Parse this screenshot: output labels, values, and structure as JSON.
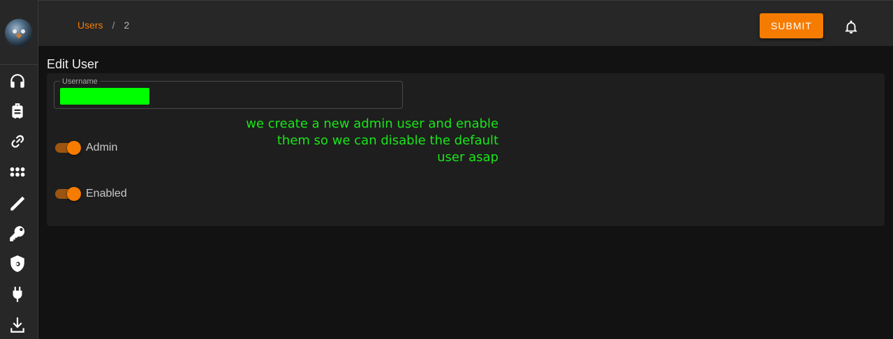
{
  "breadcrumb": {
    "parent": "Users",
    "separator": "/",
    "current": "2"
  },
  "toolbar": {
    "submit_label": "SUBMIT"
  },
  "page": {
    "title": "Edit User"
  },
  "form": {
    "username": {
      "label": "Username",
      "value": ""
    },
    "admin": {
      "label": "Admin",
      "checked": true
    },
    "enabled": {
      "label": "Enabled",
      "checked": true
    }
  },
  "annotation": {
    "line1": "we create a new admin user and enable",
    "line2": "them so we can disable the default",
    "line3": "user asap"
  },
  "sidebar": {
    "items": [
      {
        "icon": "headphones-icon"
      },
      {
        "icon": "luggage-icon"
      },
      {
        "icon": "link-icon"
      },
      {
        "icon": "apps-grid-icon"
      },
      {
        "icon": "wand-icon"
      },
      {
        "icon": "key-icon"
      },
      {
        "icon": "shield-gear-icon"
      },
      {
        "icon": "plug-icon"
      },
      {
        "icon": "download-icon"
      }
    ]
  },
  "colors": {
    "accent": "#f57c00",
    "annotation": "#19e619",
    "redaction": "#00ff00"
  }
}
